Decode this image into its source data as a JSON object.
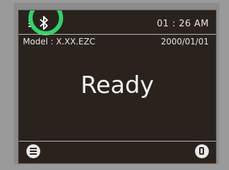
{
  "status": {
    "time": "01 : 26 AM",
    "bluetooth_icon": "bluetooth-icon",
    "battery_icon": "battery-icon"
  },
  "info": {
    "model": "Model : X.XX.EZC",
    "date": "2000/01/01"
  },
  "main": {
    "status_text": "Ready"
  },
  "footer": {
    "menu_icon": "menu-icon",
    "device_icon": "device-icon"
  },
  "colors": {
    "highlight": "#2ed46a",
    "screen_bg": "#2a221d"
  }
}
